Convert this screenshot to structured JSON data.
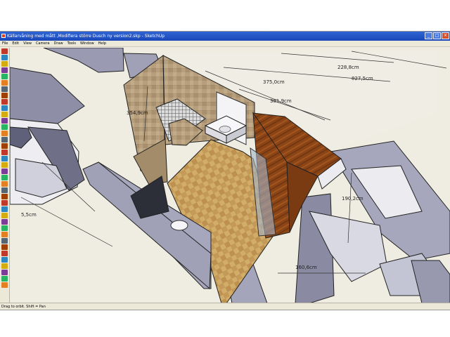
{
  "window": {
    "title": "Källarvåning med mått ,Modifiera större Dusch ny version2.skp - SketchUp"
  },
  "menu": [
    "File",
    "Edit",
    "View",
    "Camera",
    "Draw",
    "Tools",
    "Window",
    "Help"
  ],
  "toolbar": {
    "tools": [
      "select-tool",
      "component-tool",
      "paint-tool",
      "eraser-tool",
      "rectangle-tool",
      "line-tool",
      "circle-tool",
      "arc-tool",
      "polygon-tool",
      "freehand-tool",
      "move-tool",
      "push-pull-tool",
      "rotate-tool",
      "follow-me-tool",
      "scale-tool",
      "offset-tool",
      "tape-measure-tool",
      "dimension-tool",
      "protractor-tool",
      "text-tool",
      "axes-tool",
      "3d-text-tool",
      "orbit-tool",
      "pan-tool",
      "zoom-tool",
      "zoom-window-tool",
      "zoom-extents-tool",
      "previous-view-tool",
      "next-view-tool",
      "position-camera-tool",
      "walk-tool",
      "look-around-tool",
      "section-plane-tool",
      "get-models-tool",
      "share-model-tool",
      "share-component-tool",
      "sandbox-tool",
      "google-earth-tool"
    ]
  },
  "dimensions": {
    "d1": "375,0cm",
    "d2": "228,8cm",
    "d3": "827,5cm",
    "d4": "381,9cm",
    "d5": "354,9cm",
    "d6": "190,2cm",
    "d7": "160,6cm",
    "d8": "5,5cm"
  },
  "status": {
    "hint": "Drag to orbit.  Shift = Pan"
  }
}
